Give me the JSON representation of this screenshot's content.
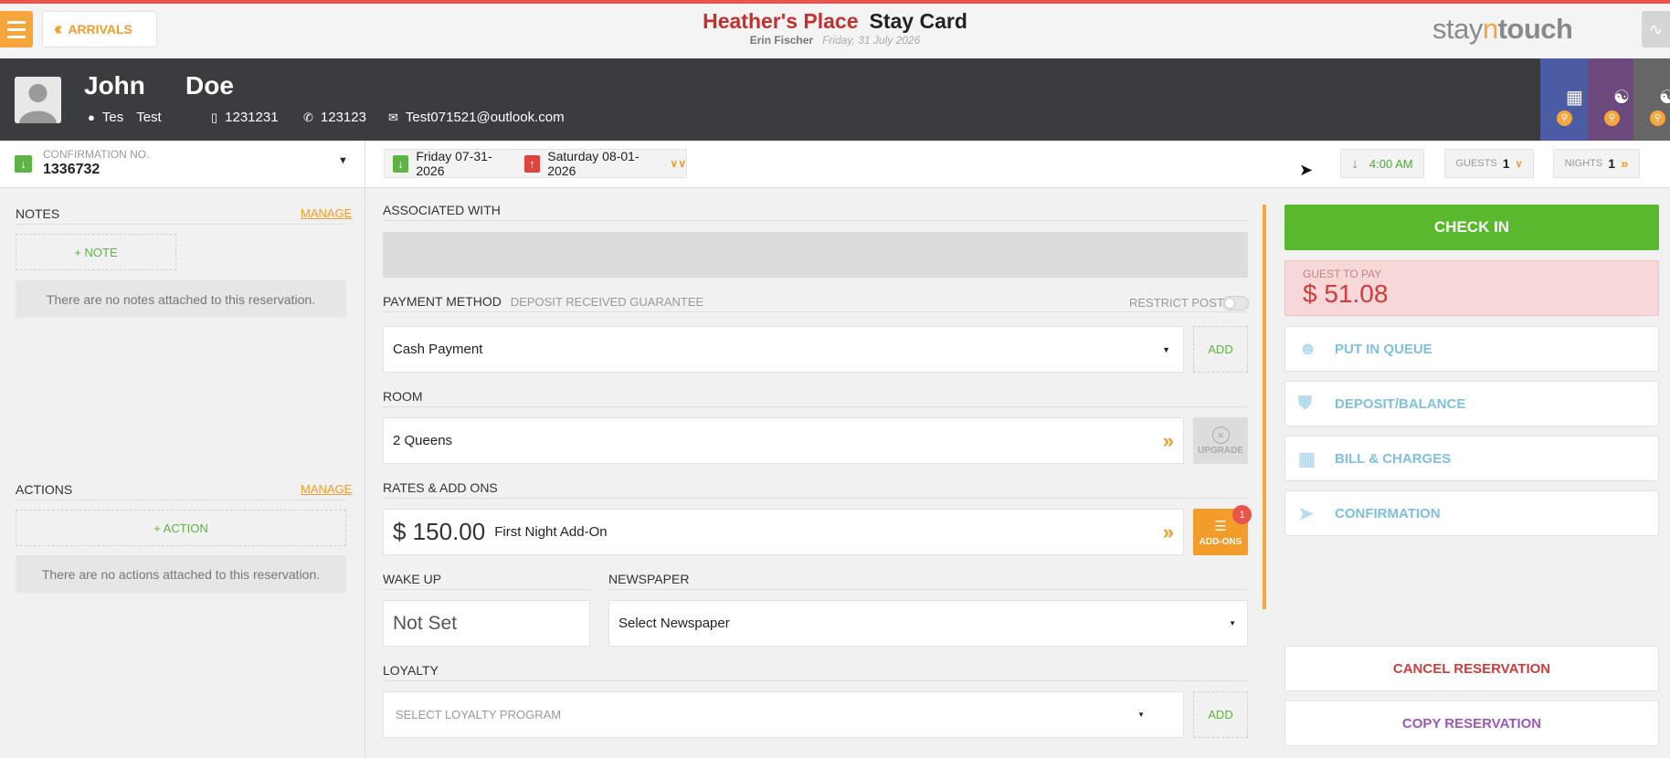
{
  "topbar": {
    "back_label": "ARRIVALS",
    "hotel_name": "Heather's Place",
    "page_name": "Stay Card",
    "user_name": "Erin Fischer",
    "business_date": "Friday, 31 July 2026",
    "logo_part1": "stay",
    "logo_part2": "n",
    "logo_part3": "touch"
  },
  "guest": {
    "first_name": "John",
    "last_name": "Doe",
    "city": "Tes",
    "state": "Test",
    "mobile": "1231231",
    "phone": "123123",
    "email": "Test071521@outlook.com"
  },
  "reservation": {
    "confirmation_label": "CONFIRMATION NO.",
    "confirmation_number": "1336732",
    "arrival_date": "Friday 07-31-2026",
    "departure_date": "Saturday 08-01-2026",
    "arrival_time": "4:00 AM",
    "guests_label": "GUESTS",
    "guests_count": "1",
    "nights_label": "NIGHTS",
    "nights_count": "1"
  },
  "notes": {
    "title": "NOTES",
    "manage": "MANAGE",
    "add_label": "+ NOTE",
    "empty": "There are no notes attached to this reservation."
  },
  "actions": {
    "title": "ACTIONS",
    "manage": "MANAGE",
    "add_label": "+ ACTION",
    "empty": "There are no actions attached to this reservation."
  },
  "details": {
    "associated_label": "ASSOCIATED WITH",
    "payment_label": "PAYMENT METHOD",
    "payment_sub": "DEPOSIT RECEIVED GUARANTEE",
    "restrict_post": "RESTRICT POST",
    "payment_value": "Cash Payment",
    "add": "ADD",
    "room_label": "ROOM",
    "room_value": "2 Queens",
    "upgrade": "UPGRADE",
    "rates_label": "RATES & ADD ONS",
    "rate_amount": "$ 150.00",
    "rate_name": "First Night Add-On",
    "addons": "ADD-ONS",
    "addons_count": "1",
    "wakeup_label": "WAKE UP",
    "wakeup_value": "Not Set",
    "newspaper_label": "NEWSPAPER",
    "newspaper_value": "Select Newspaper",
    "loyalty_label": "LOYALTY",
    "loyalty_value": "SELECT LOYALTY PROGRAM"
  },
  "right": {
    "checkin": "CHECK IN",
    "guest_to_pay_label": "GUEST TO PAY",
    "guest_to_pay_amount": "$ 51.08",
    "put_in_queue": "PUT IN QUEUE",
    "deposit_balance": "DEPOSIT/BALANCE",
    "bill_charges": "BILL & CHARGES",
    "confirmation": "CONFIRMATION",
    "cancel": "CANCEL RESERVATION",
    "copy": "COPY RESERVATION"
  },
  "colors": {
    "accent": "#f39c2a",
    "checkin_green": "#5ab82f",
    "hotel_red": "#c4302b",
    "header_dark": "#3b3c40",
    "action_blue": "#7ec0dd",
    "cancel_red": "#d03c3c",
    "copy_purple": "#9b59b6"
  }
}
